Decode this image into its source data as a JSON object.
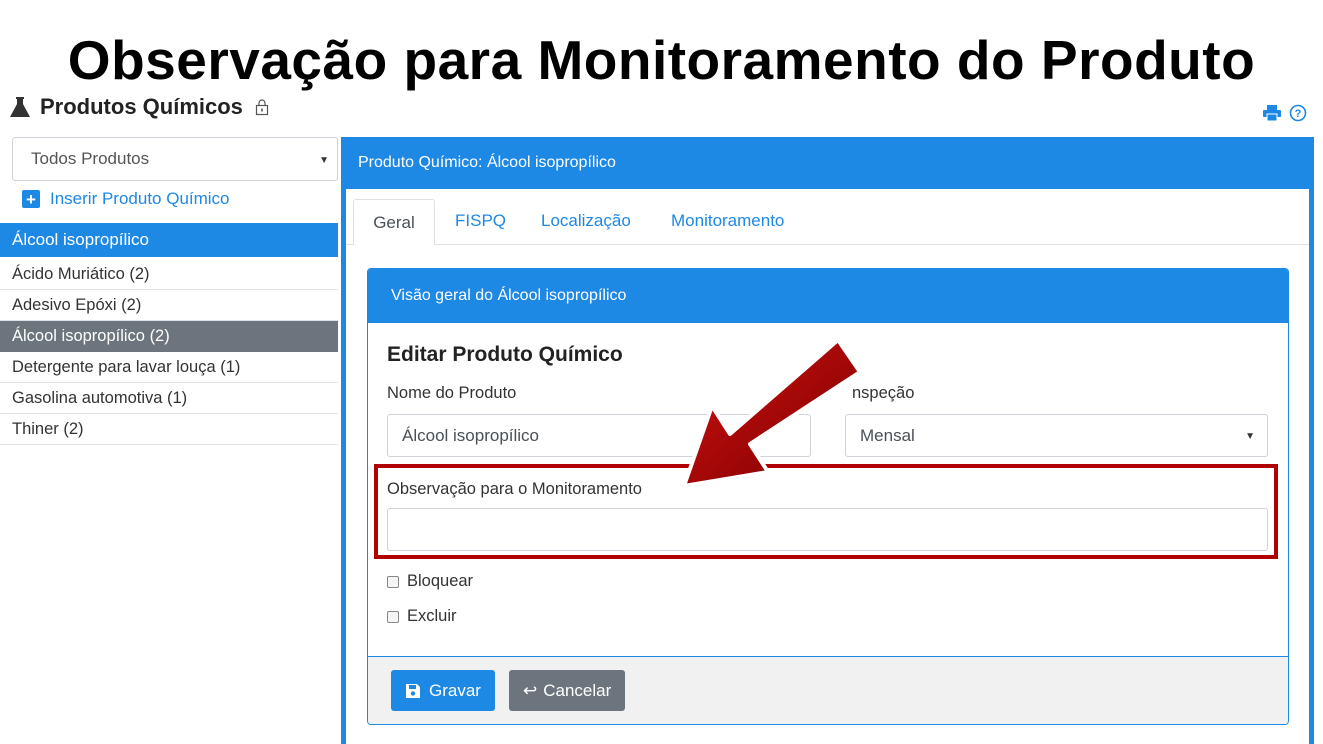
{
  "slide": {
    "title": "Observação para Monitoramento do Produto"
  },
  "header": {
    "title": "Produtos Químicos"
  },
  "sidebar": {
    "filter_value": "Todos Produtos",
    "add_label": "Inserir Produto Químico",
    "selected_item": "Álcool isopropílico",
    "items": [
      {
        "label": "Ácido Muriático (2)"
      },
      {
        "label": "Adesivo Epóxi (2)"
      },
      {
        "label": "Álcool isopropílico (2)"
      },
      {
        "label": "Detergente para lavar louça (1)"
      },
      {
        "label": "Gasolina automotiva (1)"
      },
      {
        "label": "Thiner (2)"
      }
    ]
  },
  "main": {
    "title": "Produto Químico: Álcool isopropílico",
    "tabs": [
      {
        "label": "Geral"
      },
      {
        "label": "FISPQ"
      },
      {
        "label": "Localização"
      },
      {
        "label": "Monitoramento"
      }
    ],
    "card": {
      "header": "Visão geral do Álcool isopropílico",
      "title": "Editar Produto Químico",
      "name_label": "Nome do Produto",
      "name_value": "Álcool isopropílico",
      "inspection_label": "nspeção",
      "inspection_value": "Mensal",
      "observation_label": "Observação para o Monitoramento",
      "observation_value": "",
      "block_label": "Bloquear",
      "delete_label": "Excluir",
      "save_label": "Gravar",
      "cancel_label": "Cancelar"
    }
  },
  "colors": {
    "primary": "#1e88e5",
    "secondary": "#6c757d",
    "highlight": "#b00000"
  }
}
